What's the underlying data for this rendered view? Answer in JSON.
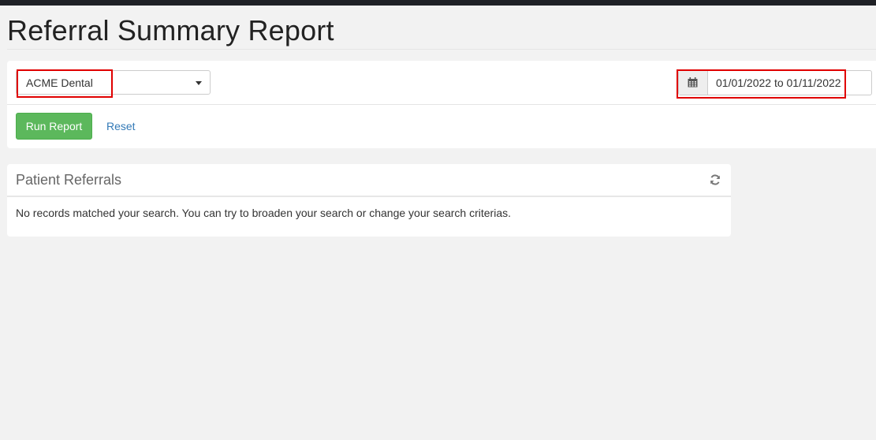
{
  "page": {
    "title": "Referral Summary Report"
  },
  "filters": {
    "practice": {
      "selected": "ACME Dental"
    },
    "date_range": {
      "value": "01/01/2022 to 01/11/2022"
    },
    "run_label": "Run Report",
    "reset_label": "Reset"
  },
  "panel": {
    "title": "Patient Referrals",
    "empty_message": "No records matched your search. You can try to broaden your search or change your search criterias."
  },
  "icons": {
    "calendar": "calendar-icon",
    "refresh": "refresh-icon",
    "caret": "chevron-down-icon"
  },
  "colors": {
    "primary_button": "#5cb85c",
    "link": "#337ab7",
    "highlight": "#e00000"
  }
}
